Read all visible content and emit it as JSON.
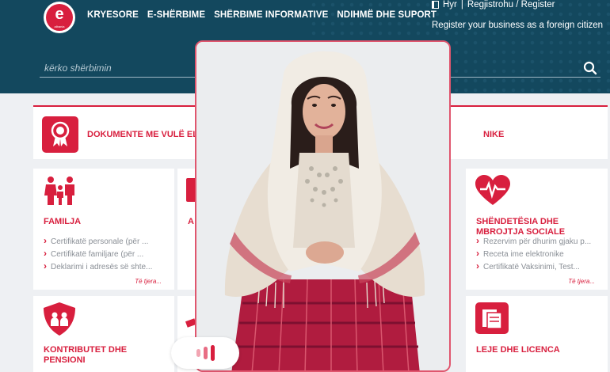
{
  "header": {
    "logo_text": "e",
    "logo_sub": "albania",
    "nav": [
      "KRYESORE",
      "E-SHËRBIME",
      "SHËRBIME INFORMATIVE",
      "NDIHMË DHE SUPORT"
    ],
    "login": "Hyr",
    "separator": "|",
    "register": "Regjistrohu / Register",
    "foreign": "Register your business as a foreign citizen",
    "search_placeholder": "kërko shërbimin"
  },
  "banner": {
    "title": "DOKUMENTE ME VULË EL",
    "title_end": "NIKE"
  },
  "cards": {
    "family": {
      "title": "FAMILJA",
      "items": [
        "Certifikatë personale (për ...",
        "Certifikatë familjare (për ...",
        "Deklarimi i adresës së shte..."
      ],
      "more": "Të tjera..."
    },
    "health": {
      "title": "SHËNDETËSIA DHE MBROJTJA SOCIALE",
      "items": [
        "Rezervim për dhurim gjaku p...",
        "Receta ime elektronike",
        "Certifikatë Vaksinimi, Test..."
      ],
      "more": "Të tjera..."
    },
    "contrib": {
      "title": "KONTRIBUTET DHE PENSIONI"
    },
    "permits": {
      "title": "LEJE DHE LICENCA"
    },
    "partial_a": {
      "title": "A"
    }
  },
  "colors": {
    "brand_red": "#d81f3e",
    "header_blue": "#13485e"
  }
}
